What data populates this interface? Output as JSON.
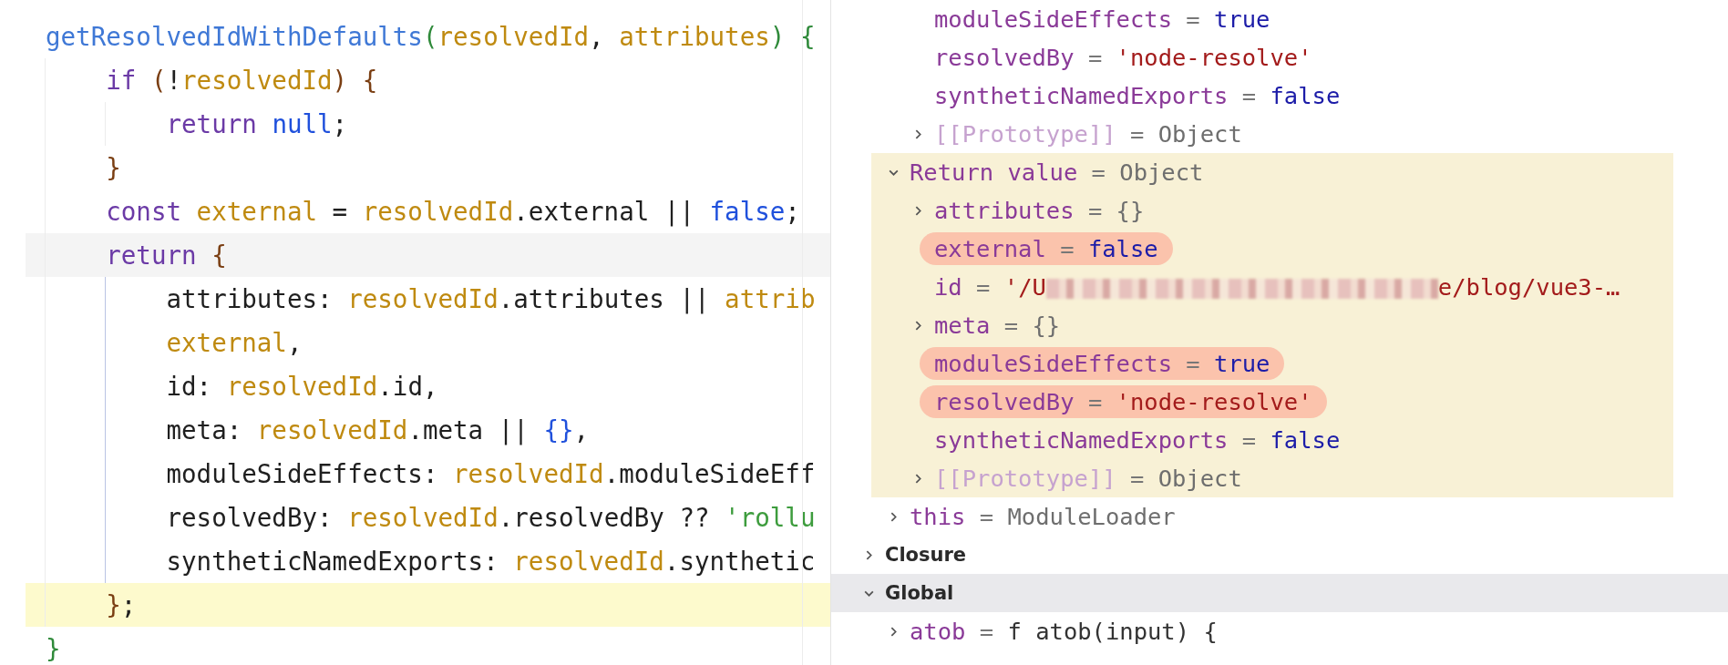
{
  "editor": {
    "lines": [
      {
        "kind": "plain",
        "tokens": [
          {
            "text": "getResolvedIdWithDefaults",
            "kind": "fn"
          },
          {
            "text": "(",
            "kind": "paren"
          },
          {
            "text": "resolvedId",
            "kind": "ident"
          },
          {
            "text": ", ",
            "kind": "plain"
          },
          {
            "text": "attributes",
            "kind": "ident"
          },
          {
            "text": ") {",
            "kind": "paren"
          }
        ]
      },
      {
        "kind": "plain",
        "tokens": [
          {
            "text": "    if ",
            "kind": "kw"
          },
          {
            "text": "(",
            "kind": "brace"
          },
          {
            "text": "!",
            "kind": "plain"
          },
          {
            "text": "resolvedId",
            "kind": "ident"
          },
          {
            "text": ") {",
            "kind": "brace"
          }
        ]
      },
      {
        "kind": "plain",
        "tokens": [
          {
            "text": "        return ",
            "kind": "kw"
          },
          {
            "text": "null",
            "kind": "lit"
          },
          {
            "text": ";",
            "kind": "plain"
          }
        ]
      },
      {
        "kind": "plain",
        "tokens": [
          {
            "text": "    }",
            "kind": "brace"
          }
        ]
      },
      {
        "kind": "plain",
        "tokens": [
          {
            "text": "    const ",
            "kind": "kw"
          },
          {
            "text": "external",
            "kind": "ident"
          },
          {
            "text": " = ",
            "kind": "plain"
          },
          {
            "text": "resolvedId",
            "kind": "ident"
          },
          {
            "text": ".external || ",
            "kind": "plain"
          },
          {
            "text": "false",
            "kind": "lit"
          },
          {
            "text": ";",
            "kind": "plain"
          }
        ]
      },
      {
        "kind": "caret",
        "tokens": [
          {
            "text": "    return ",
            "kind": "kw"
          },
          {
            "text": "{",
            "kind": "brace"
          }
        ]
      },
      {
        "kind": "plain",
        "tokens": [
          {
            "text": "        attributes: ",
            "kind": "plain"
          },
          {
            "text": "resolvedId",
            "kind": "ident"
          },
          {
            "text": ".attributes || ",
            "kind": "plain"
          },
          {
            "text": "attrib",
            "kind": "ident"
          }
        ]
      },
      {
        "kind": "plain",
        "tokens": [
          {
            "text": "        external",
            "kind": "ident"
          },
          {
            "text": ",",
            "kind": "plain"
          }
        ]
      },
      {
        "kind": "plain",
        "tokens": [
          {
            "text": "        id: ",
            "kind": "plain"
          },
          {
            "text": "resolvedId",
            "kind": "ident"
          },
          {
            "text": ".id,",
            "kind": "plain"
          }
        ]
      },
      {
        "kind": "plain",
        "tokens": [
          {
            "text": "        meta: ",
            "kind": "plain"
          },
          {
            "text": "resolvedId",
            "kind": "ident"
          },
          {
            "text": ".meta || ",
            "kind": "plain"
          },
          {
            "text": "{}",
            "kind": "lit"
          },
          {
            "text": ",",
            "kind": "plain"
          }
        ]
      },
      {
        "kind": "plain",
        "tokens": [
          {
            "text": "        moduleSideEffects: ",
            "kind": "plain"
          },
          {
            "text": "resolvedId",
            "kind": "ident"
          },
          {
            "text": ".moduleSideEff",
            "kind": "plain"
          }
        ]
      },
      {
        "kind": "plain",
        "tokens": [
          {
            "text": "        resolvedBy: ",
            "kind": "plain"
          },
          {
            "text": "resolvedId",
            "kind": "ident"
          },
          {
            "text": ".resolvedBy ?? ",
            "kind": "plain"
          },
          {
            "text": "'rollu",
            "kind": "str"
          }
        ]
      },
      {
        "kind": "plain",
        "tokens": [
          {
            "text": "        syntheticNamedExports: ",
            "kind": "plain"
          },
          {
            "text": "resolvedId",
            "kind": "ident"
          },
          {
            "text": ".synthetic",
            "kind": "plain"
          }
        ]
      },
      {
        "kind": "execution",
        "tokens": [
          {
            "text": "    }",
            "kind": "brace"
          },
          {
            "text": ";",
            "kind": "plain"
          }
        ]
      },
      {
        "kind": "plain",
        "tokens": [
          {
            "text": "}",
            "kind": "paren"
          }
        ]
      }
    ]
  },
  "scope": {
    "variables": [
      {
        "children": [
          {
            "name": "moduleSideEffects",
            "kind": "property",
            "sign": "=",
            "value": {
              "text": "true",
              "kind": "bool"
            },
            "marked": false
          },
          {
            "name": "resolvedBy",
            "kind": "property",
            "sign": "=",
            "value": {
              "text": "'node-resolve'",
              "kind": "string"
            },
            "marked": false
          },
          {
            "name": "syntheticNamedExports",
            "kind": "property",
            "sign": "=",
            "value": {
              "text": "false",
              "kind": "bool"
            },
            "marked": false
          },
          {
            "name": "[[Prototype]]",
            "kind": "internal",
            "sign": "=",
            "value": {
              "text": "Object",
              "kind": "object"
            },
            "expanded": false,
            "marked": false
          }
        ]
      },
      {
        "name": "Return value",
        "kind": "property",
        "sign": "=",
        "value": {
          "text": "Object",
          "kind": "object"
        },
        "expanded": true,
        "highlighted": true,
        "marked": false,
        "children": [
          {
            "name": "attributes",
            "kind": "property",
            "sign": "=",
            "value": {
              "text": "{}",
              "kind": "object"
            },
            "expanded": false,
            "marked": false
          },
          {
            "name": "external",
            "kind": "property",
            "sign": "=",
            "value": {
              "text": "false",
              "kind": "bool"
            },
            "marked": true
          },
          {
            "name": "id",
            "kind": "property",
            "sign": "=",
            "value": {
              "text": "'/U",
              "kind": "string",
              "redacted": true,
              "end": "e/blog/vue3-…"
            },
            "marked": false
          },
          {
            "name": "meta",
            "kind": "property",
            "sign": "=",
            "value": {
              "text": "{}",
              "kind": "object"
            },
            "expanded": false,
            "marked": false
          },
          {
            "name": "moduleSideEffects",
            "kind": "property",
            "sign": "=",
            "value": {
              "text": "true",
              "kind": "bool"
            },
            "marked": true
          },
          {
            "name": "resolvedBy",
            "kind": "property",
            "sign": "=",
            "value": {
              "text": "'node-resolve'",
              "kind": "string"
            },
            "marked": true
          },
          {
            "name": "syntheticNamedExports",
            "kind": "property",
            "sign": "=",
            "value": {
              "text": "false",
              "kind": "bool"
            },
            "marked": false
          },
          {
            "name": "[[Prototype]]",
            "kind": "internal",
            "sign": "=",
            "value": {
              "text": "Object",
              "kind": "object"
            },
            "expanded": false,
            "marked": false
          }
        ]
      },
      {
        "name": "this",
        "kind": "property",
        "sign": "=",
        "value": {
          "text": "ModuleLoader",
          "kind": "object"
        },
        "expanded": false,
        "marked": false
      }
    ],
    "sections": [
      {
        "title": "Closure",
        "expanded": false,
        "selected": false
      },
      {
        "title": "Global",
        "expanded": true,
        "selected": true,
        "children": [
          {
            "name": "atob",
            "kind": "property",
            "sign": "=",
            "value": {
              "text": "f atob(input) {",
              "kind": "function"
            },
            "expanded": false,
            "marked": false
          }
        ]
      }
    ]
  }
}
